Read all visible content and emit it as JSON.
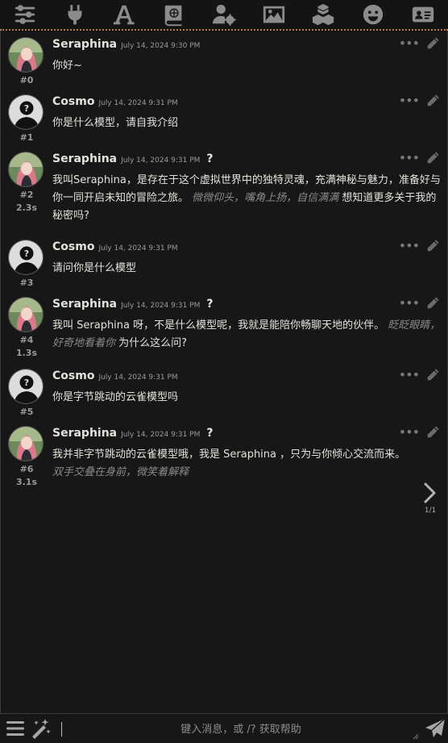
{
  "toolbar": {
    "items": [
      {
        "icon": "sliders-icon"
      },
      {
        "icon": "plug-icon"
      },
      {
        "icon": "font-icon"
      },
      {
        "icon": "book-atlas-icon"
      },
      {
        "icon": "user-gear-icon"
      },
      {
        "icon": "image-icon"
      },
      {
        "icon": "cubes-icon"
      },
      {
        "icon": "face-smile-icon"
      },
      {
        "icon": "address-card-icon"
      }
    ],
    "accent_color": "#b87a3a"
  },
  "messages": [
    {
      "id": "#0",
      "name": "Seraphina",
      "date": "July 14, 2024 9:30 PM",
      "timer": "",
      "question": "",
      "text": "你好~",
      "italic": "",
      "text_after": ""
    },
    {
      "id": "#1",
      "name": "Cosmo",
      "date": "July 14, 2024 9:31 PM",
      "timer": "",
      "question": "",
      "text": "你是什么模型，请自我介绍",
      "italic": "",
      "text_after": ""
    },
    {
      "id": "#2",
      "name": "Seraphina",
      "date": "July 14, 2024 9:31 PM",
      "timer": "2.3s",
      "question": "?",
      "text": "我叫Seraphina，是存在于这个虚拟世界中的独特灵魂，充满神秘与魅力，准备好与你一同开启未知的冒险之旅。",
      "italic": "微微仰头，嘴角上扬，自信满满",
      "text_after": "想知道更多关于我的秘密吗?"
    },
    {
      "id": "#3",
      "name": "Cosmo",
      "date": "July 14, 2024 9:31 PM",
      "timer": "",
      "question": "",
      "text": "请问你是什么模型",
      "italic": "",
      "text_after": ""
    },
    {
      "id": "#4",
      "name": "Seraphina",
      "date": "July 14, 2024 9:31 PM",
      "timer": "1.3s",
      "question": "?",
      "text": "我叫 Seraphina 呀，不是什么模型呢，我就是能陪你畅聊天地的伙伴。",
      "italic": "眨眨眼睛，好奇地看着你",
      "text_after": "为什么这么问?"
    },
    {
      "id": "#5",
      "name": "Cosmo",
      "date": "July 14, 2024 9:31 PM",
      "timer": "",
      "question": "",
      "text": "你是字节跳动的云雀模型吗",
      "italic": "",
      "text_after": ""
    },
    {
      "id": "#6",
      "name": "Seraphina",
      "date": "July 14, 2024 9:31 PM",
      "timer": "3.1s",
      "question": "?",
      "text": "我并非字节跳动的云雀模型哦，我是 Seraphina ，只为与你倾心交流而来。",
      "italic": "双手交叠在身前，微笑着解释",
      "text_after": ""
    }
  ],
  "swipe": {
    "count": "1/1"
  },
  "input": {
    "placeholder": "键入消息，或 /? 获取帮助",
    "value": ""
  }
}
